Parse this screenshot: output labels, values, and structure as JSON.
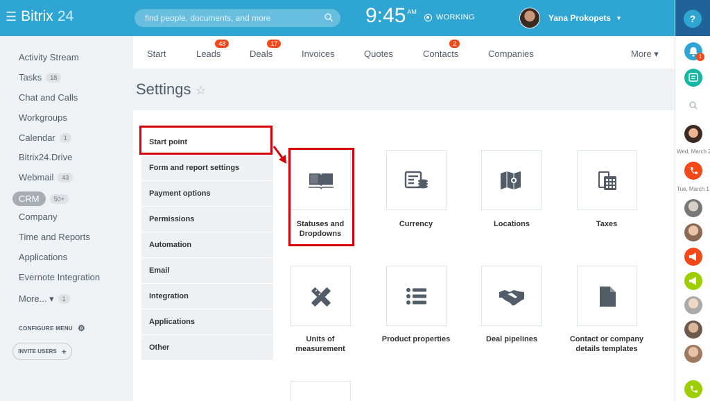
{
  "header": {
    "logo_main": "Bitrix",
    "logo_num": "24",
    "search_placeholder": "find people, documents, and more",
    "time": "9:45",
    "ampm": "AM",
    "status": "WORKING",
    "user_name": "Yana Prokopets"
  },
  "right_panel": {
    "help": "?",
    "notif_count": "1",
    "date1": "Wed, March 2",
    "date2": "Tue, March 1"
  },
  "left_menu": {
    "items": [
      {
        "label": "Activity Stream",
        "count": ""
      },
      {
        "label": "Tasks",
        "count": "18"
      },
      {
        "label": "Chat and Calls",
        "count": ""
      },
      {
        "label": "Workgroups",
        "count": ""
      },
      {
        "label": "Calendar",
        "count": "1"
      },
      {
        "label": "Bitrix24.Drive",
        "count": ""
      },
      {
        "label": "Webmail",
        "count": "43"
      },
      {
        "label": "CRM",
        "count": "50+"
      },
      {
        "label": "Company",
        "count": ""
      },
      {
        "label": "Time and Reports",
        "count": ""
      },
      {
        "label": "Applications",
        "count": ""
      },
      {
        "label": "Evernote Integration",
        "count": ""
      },
      {
        "label": "More... ▾",
        "count": "1"
      }
    ],
    "configure": "CONFIGURE MENU",
    "invite": "INVITE USERS"
  },
  "nav": {
    "tabs": [
      {
        "label": "Start",
        "badge": ""
      },
      {
        "label": "Leads",
        "badge": "48"
      },
      {
        "label": "Deals",
        "badge": "17"
      },
      {
        "label": "Invoices",
        "badge": ""
      },
      {
        "label": "Quotes",
        "badge": ""
      },
      {
        "label": "Contacts",
        "badge": "2"
      },
      {
        "label": "Companies",
        "badge": ""
      },
      {
        "label": "More ▾",
        "badge": ""
      }
    ]
  },
  "page": {
    "title": "Settings",
    "star": "☆"
  },
  "settings_menu": [
    "Start point",
    "Form and report settings",
    "Payment options",
    "Permissions",
    "Automation",
    "Email",
    "Integration",
    "Applications",
    "Other"
  ],
  "tiles": [
    {
      "label_l1": "Statuses and",
      "label_l2": "Dropdowns",
      "icon": "book-icon"
    },
    {
      "label_l1": "Currency",
      "label_l2": "",
      "icon": "currency-icon"
    },
    {
      "label_l1": "Locations",
      "label_l2": "",
      "icon": "map-icon"
    },
    {
      "label_l1": "Taxes",
      "label_l2": "",
      "icon": "calculator-icon"
    },
    {
      "label_l1": "Units of",
      "label_l2": "measurement",
      "icon": "ruler-pencil-icon"
    },
    {
      "label_l1": "Product properties",
      "label_l2": "",
      "icon": "list-icon"
    },
    {
      "label_l1": "Deal pipelines",
      "label_l2": "",
      "icon": "handshake-icon"
    },
    {
      "label_l1": "Contact or company",
      "label_l2": "details templates",
      "icon": "document-icon"
    }
  ],
  "colors": {
    "accent": "#2fa5d3",
    "highlight": "#d5000a",
    "badge": "#f54819"
  }
}
